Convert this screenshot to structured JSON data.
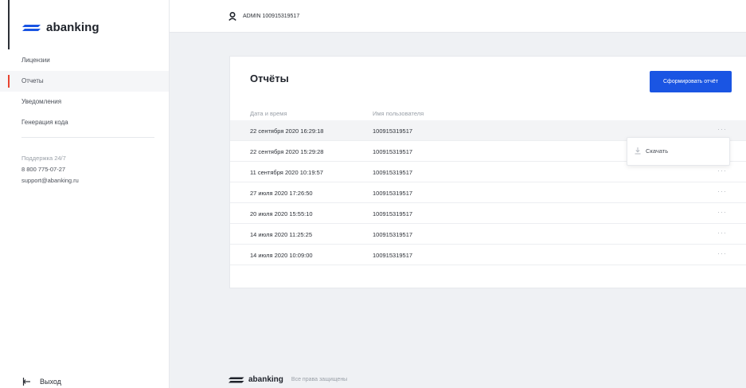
{
  "brand": {
    "name": "abanking",
    "accent": "#1a55e3",
    "active_marker": "#e8432f"
  },
  "sidebar": {
    "items": [
      {
        "label": "Лицензии",
        "active": false
      },
      {
        "label": "Отчеты",
        "active": true
      },
      {
        "label": "Уведомления",
        "active": false
      },
      {
        "label": "Генерация кода",
        "active": false
      }
    ],
    "support": {
      "title": "Поддержка 24/7",
      "phone": "8 800 775-07-27",
      "email": "support@abanking.ru"
    },
    "logout_label": "Выход",
    "logout_icon": "logout-icon"
  },
  "header": {
    "user_icon": "user-icon",
    "user_label": "ADMIN 100915319517"
  },
  "reports": {
    "title": "Отчёты",
    "generate_button": "Сформировать отчёт",
    "columns": {
      "date": "Дата и время",
      "user": "Имя пользователя"
    },
    "rows": [
      {
        "date": "22 сентября 2020 16:29:18",
        "user": "100915319517",
        "more": "···"
      },
      {
        "date": "22 сентября 2020 15:29:28",
        "user": "100915319517",
        "more": "···"
      },
      {
        "date": "11 сентября 2020 10:19:57",
        "user": "100915319517",
        "more": "···"
      },
      {
        "date": "27 июля 2020 17:26:50",
        "user": "100915319517",
        "more": "···"
      },
      {
        "date": "20 июля 2020 15:55:10",
        "user": "100915319517",
        "more": "···"
      },
      {
        "date": "14 июля 2020 11:25:25",
        "user": "100915319517",
        "more": "···"
      },
      {
        "date": "14 июля 2020 10:09:00",
        "user": "100915319517",
        "more": "···"
      }
    ],
    "menu": {
      "download_label": "Скачать",
      "download_icon": "download-icon"
    }
  },
  "footer": {
    "brand": "abanking",
    "rights": "Все права защищены"
  }
}
